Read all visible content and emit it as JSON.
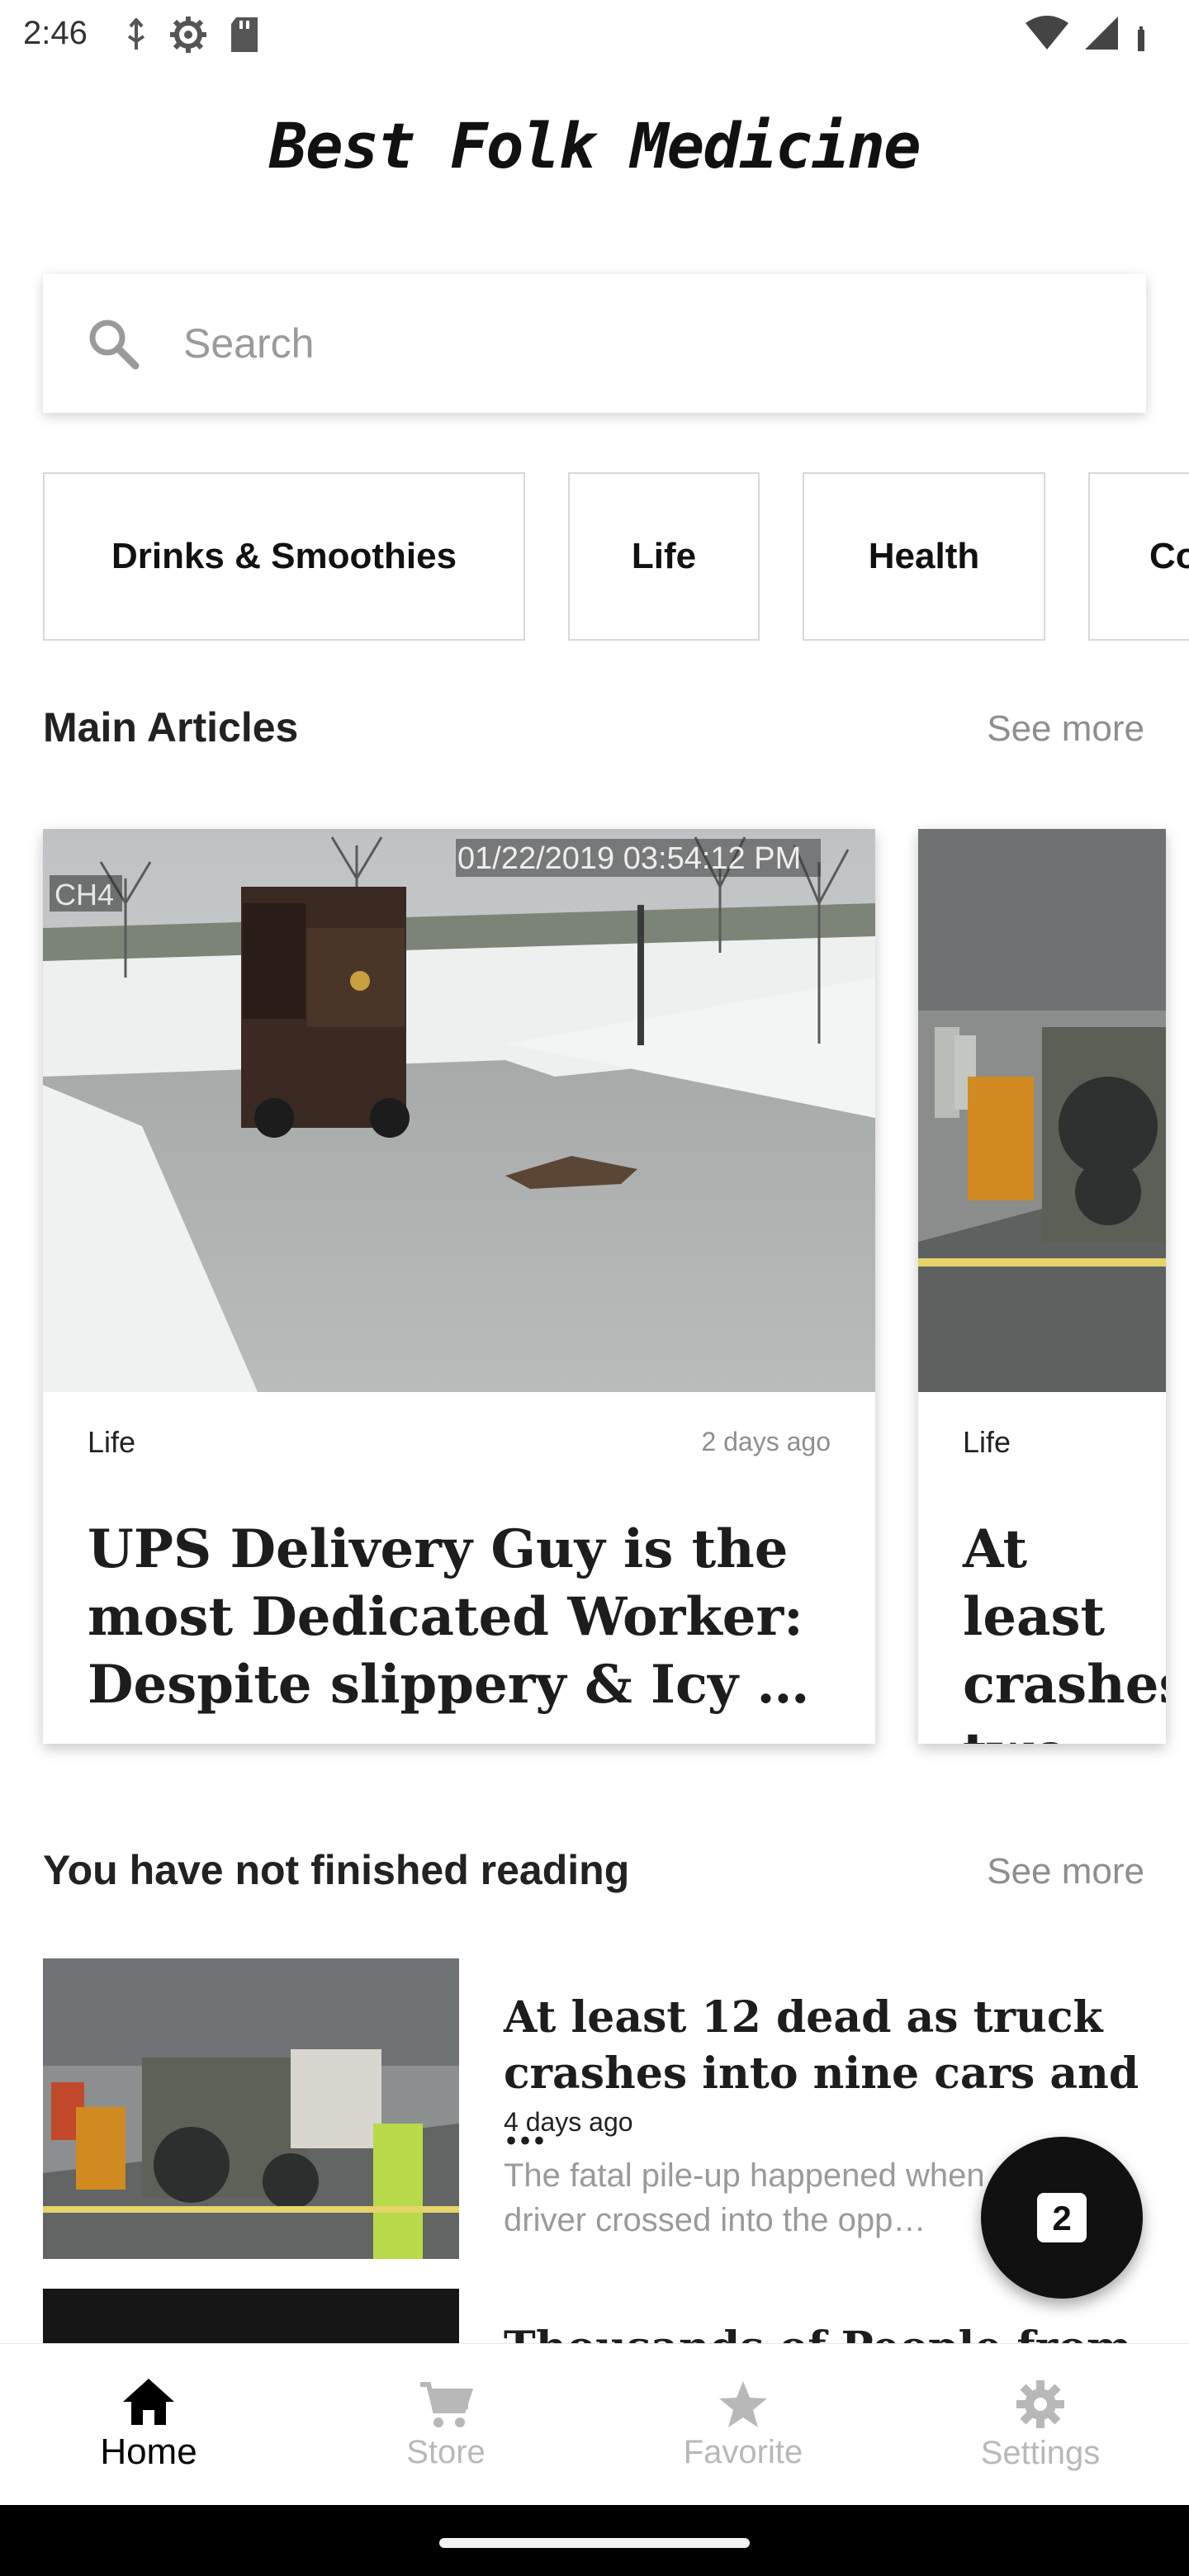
{
  "status_bar": {
    "time": "2:46"
  },
  "app": {
    "title": "Best Folk Medicine"
  },
  "search": {
    "placeholder": "Search"
  },
  "categories": [
    {
      "label": "Drinks & Smoothies"
    },
    {
      "label": "Life"
    },
    {
      "label": "Health"
    },
    {
      "label": "Co"
    }
  ],
  "main_articles": {
    "heading": "Main Articles",
    "see_more": "See more",
    "cards": [
      {
        "category": "Life",
        "time": "2 days ago",
        "title": "UPS Delivery Guy is the most Dedicated Worker: Despite slippery & Icy …",
        "image_overlay_channel": "CH4",
        "image_overlay_timestamp": "01/22/2019 03:54:12 PM"
      },
      {
        "category": "Life",
        "title": "At least crashes two mi"
      }
    ]
  },
  "unfinished": {
    "heading": "You have not finished reading",
    "see_more": "See more",
    "items": [
      {
        "title": "At least 12 dead as truck crashes into nine cars and …",
        "time": "4 days ago",
        "excerpt": "The fatal pile-up happened when a truck driver crossed into the opp…"
      },
      {
        "title": "Thousands of People from"
      }
    ]
  },
  "fab": {
    "badge": "2"
  },
  "bottom_nav": [
    {
      "label": "Home",
      "icon": "home-icon",
      "active": true
    },
    {
      "label": "Store",
      "icon": "cart-icon",
      "active": false
    },
    {
      "label": "Favorite",
      "icon": "star-icon",
      "active": false
    },
    {
      "label": "Settings",
      "icon": "gear-icon",
      "active": false
    }
  ],
  "colors": {
    "accent": "#111111",
    "muted": "#8e8e8e",
    "inactive_nav": "#b8b8b8"
  }
}
